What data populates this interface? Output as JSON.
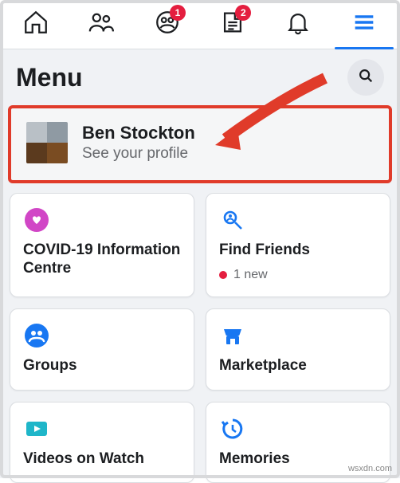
{
  "nav": {
    "group_badge": "1",
    "news_badge": "2"
  },
  "menu": {
    "title": "Menu"
  },
  "profile": {
    "name": "Ben Stockton",
    "sub": "See your profile"
  },
  "cards": {
    "covid": "COVID-19 Information Centre",
    "find_friends": "Find Friends",
    "find_friends_sub": "1 new",
    "groups": "Groups",
    "marketplace": "Marketplace",
    "videos": "Videos on Watch",
    "memories": "Memories"
  },
  "watermark": "wsxdn.com"
}
